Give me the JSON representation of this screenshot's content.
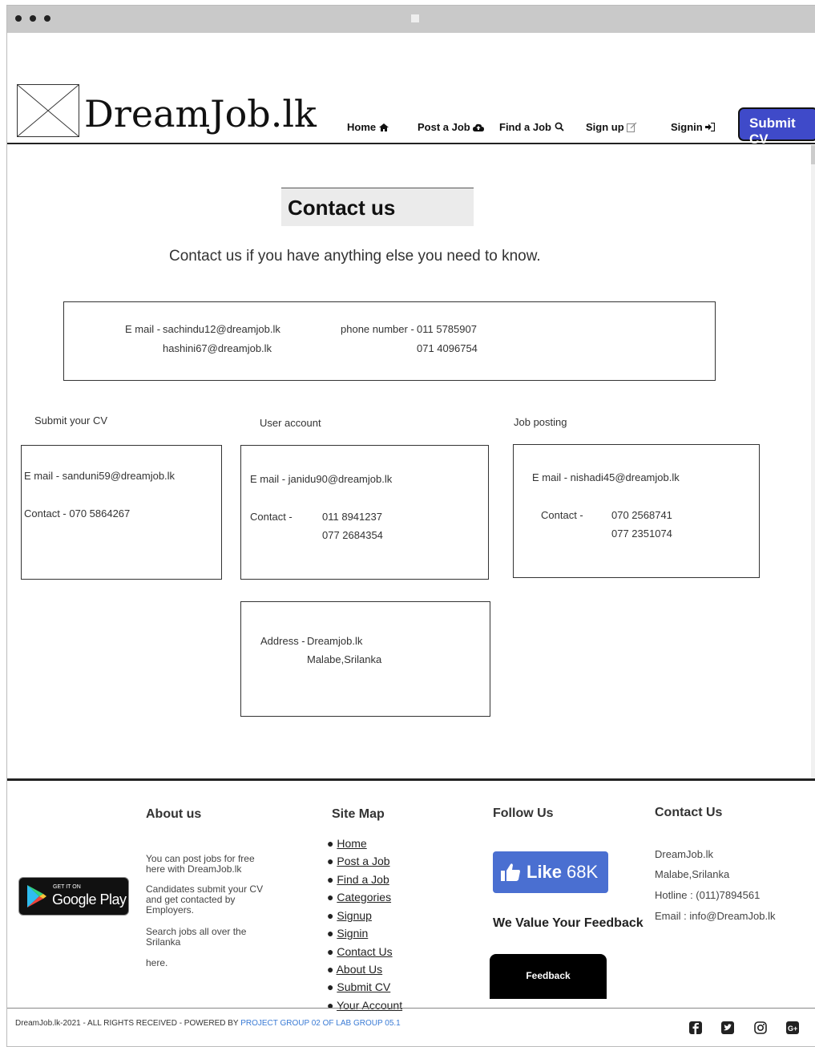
{
  "brand": {
    "name": "DreamJob.lk"
  },
  "nav": {
    "home": "Home",
    "post_job": "Post a Job",
    "find_job": "Find a Job",
    "sign_up": "Sign up",
    "signin": "Signin",
    "submit_cv": "Submit CV"
  },
  "main": {
    "title": "Contact us",
    "subtitle": "Contact us if you have anything else you need to know.",
    "general": {
      "email_label": "E mail -",
      "email_1": "sachindu12@dreamjob.lk",
      "email_2": "hashini67@dreamjob.lk",
      "phone_label": "phone number -",
      "phone_1": "011 5785907",
      "phone_2": "071 4096754"
    },
    "submit_cv": {
      "heading": "Submit your CV",
      "email": "E mail - sanduni59@dreamjob.lk",
      "contact": "Contact -  070 5864267"
    },
    "user_account": {
      "heading": "User account",
      "email": "E mail - janidu90@dreamjob.lk",
      "contact_label": "Contact -",
      "phone_1": "011 8941237",
      "phone_2": "077 2684354"
    },
    "job_posting": {
      "heading": "Job posting",
      "email": "E mail - nishadi45@dreamjob.lk",
      "contact_label": "Contact  -",
      "phone_1": "070 2568741",
      "phone_2": "077 2351074"
    },
    "address": {
      "label": "Address -",
      "line_1": "Dreamjob.lk",
      "line_2": "Malabe,Srilanka"
    }
  },
  "footer": {
    "google_play": {
      "small": "GET IT ON",
      "big": "Google Play"
    },
    "about": {
      "heading": "About us",
      "p1": "You can post jobs for free here with DreamJob.lk",
      "p2": "Candidates submit your CV and get contacted by Employers.",
      "p3": "Search jobs all over the Srilanka",
      "p4": "here."
    },
    "sitemap": {
      "heading": "Site Map",
      "items": [
        "Home",
        "Post a Job",
        "Find a Job",
        "Categories",
        "Signup",
        "Signin",
        "Contact Us",
        "About Us",
        "Submit CV",
        "Your Account"
      ]
    },
    "follow": {
      "heading": "Follow Us",
      "like_label": "Like",
      "like_count": "68K",
      "feedback_heading": "We Value Your Feedback",
      "feedback_button": "Feedback"
    },
    "contact": {
      "heading": "Contact Us",
      "line_1": "DreamJob.lk",
      "line_2": "Malabe,Srilanka",
      "hotline": "Hotline : (011)7894561",
      "email": "Email  : info@DreamJob.lk"
    },
    "copyright": "DreamJob.lk-2021 - ALL RIGHTS RECEIVED - POWERED BY ",
    "powered_by": "PROJECT GROUP 02 OF LAB GROUP 05.1"
  },
  "colors": {
    "accent": "#3f4ac9",
    "like": "#4a6fd1",
    "link": "#3a7bd5"
  },
  "icons": [
    "home-icon",
    "cloud-upload-icon",
    "search-icon",
    "edit-icon",
    "sign-in-icon",
    "facebook-icon",
    "twitter-icon",
    "instagram-icon",
    "google-plus-icon",
    "thumbs-up-icon",
    "google-play-icon"
  ]
}
